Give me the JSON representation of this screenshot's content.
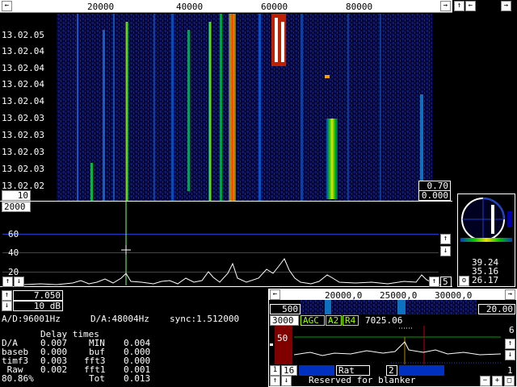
{
  "waterfall": {
    "freq_ticks": [
      "20000",
      "40000",
      "60000",
      "80000"
    ],
    "time_labels": [
      "13.02.05",
      "13.02.04",
      "13.02.04",
      "13.02.04",
      "13.02.04",
      "13.02.03",
      "13.02.03",
      "13.02.03",
      "13.02.03",
      "13.02.02"
    ],
    "zoom_value": "10",
    "gain_top": "0.70",
    "gain_bottom": "0.000"
  },
  "spectrum": {
    "top_value": "2000",
    "y_labels": [
      "60",
      "40",
      "20"
    ],
    "right_value": "5",
    "avg_value": "7.050",
    "db_value": "10 dB"
  },
  "status": {
    "ad_rate": "A/D:96001Hz",
    "da_rate": "D/A:48004Hz",
    "sync": "sync:1.512000"
  },
  "delay": {
    "title": "Delay times",
    "rows": [
      [
        "D/A",
        "0.007",
        "MIN",
        "0.004"
      ],
      [
        "baseb",
        "0.000",
        "buf",
        "0.000"
      ],
      [
        "timf3",
        "0.003",
        "fft3",
        "0.000"
      ],
      [
        " Raw",
        "0.002",
        "fft1",
        "0.001"
      ],
      [
        "80.86%",
        "",
        "Tot",
        "0.013"
      ]
    ]
  },
  "meter": {
    "v1": "39.24",
    "v2": "35.16",
    "v3": "26.17",
    "button": "o"
  },
  "baseband": {
    "freq_ticks": [
      "20000,0",
      "25000,0",
      "30000,0"
    ],
    "left_value": "500",
    "right_value": "20.00",
    "bw_value": "3000",
    "agc_label": "AGC",
    "a_label": "A2",
    "r_label": "R4",
    "freq_readout": "7025.06",
    "level_value": "50",
    "right_scale_top": "6",
    "right_scale_bottom": "1",
    "bottom_left_1": "1",
    "bottom_left_2": "16",
    "rat_label": "Rat",
    "rat_value": "2",
    "blanker_text": "Reserved for blanker",
    "minus_btn": "−",
    "plus_btn": "+"
  },
  "colors": {
    "blue_line": "#1a40c8",
    "red": "#c00000",
    "dark_red": "#800000",
    "green": "#00a000",
    "yellow": "#f0f000"
  }
}
